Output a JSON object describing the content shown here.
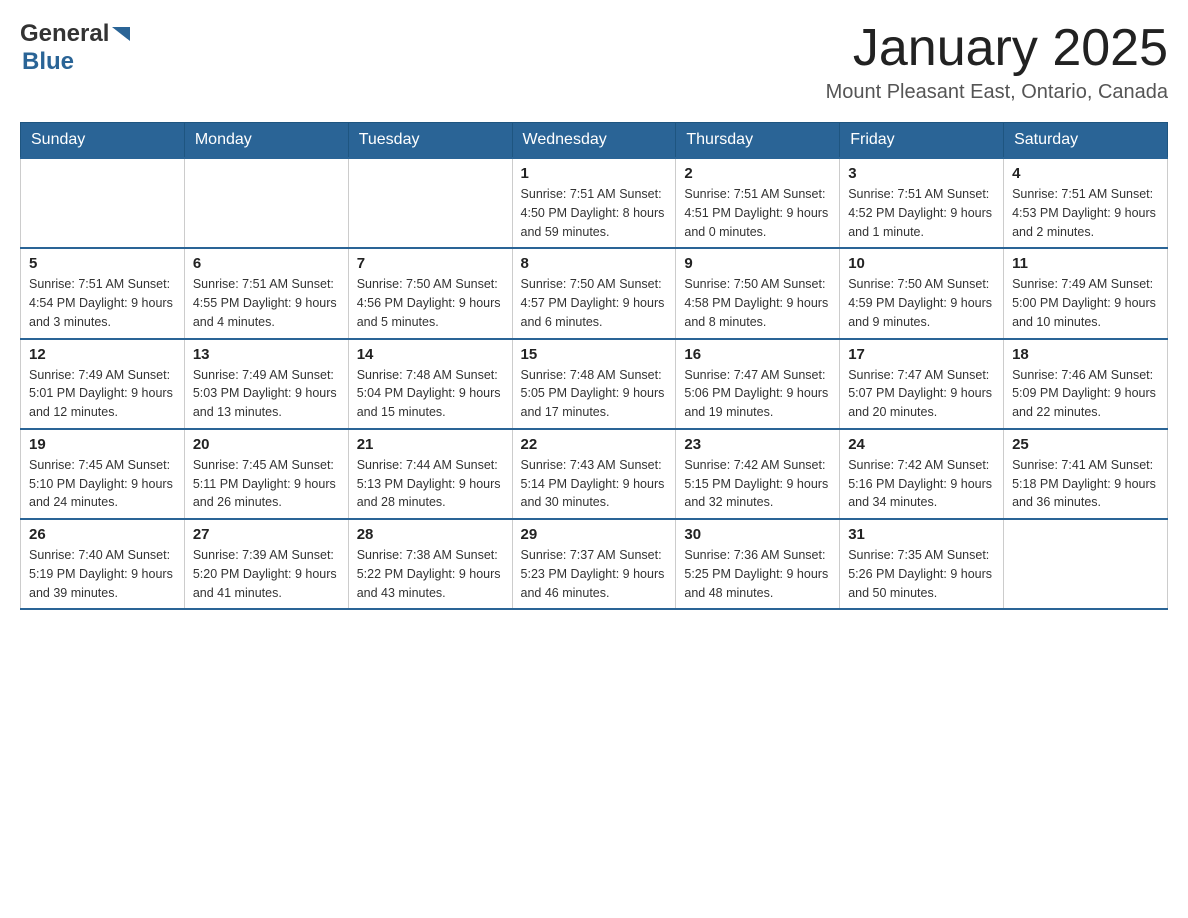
{
  "header": {
    "title": "January 2025",
    "subtitle": "Mount Pleasant East, Ontario, Canada",
    "logo_general": "General",
    "logo_blue": "Blue"
  },
  "days_of_week": [
    "Sunday",
    "Monday",
    "Tuesday",
    "Wednesday",
    "Thursday",
    "Friday",
    "Saturday"
  ],
  "weeks": [
    [
      {
        "day": "",
        "info": ""
      },
      {
        "day": "",
        "info": ""
      },
      {
        "day": "",
        "info": ""
      },
      {
        "day": "1",
        "info": "Sunrise: 7:51 AM\nSunset: 4:50 PM\nDaylight: 8 hours\nand 59 minutes."
      },
      {
        "day": "2",
        "info": "Sunrise: 7:51 AM\nSunset: 4:51 PM\nDaylight: 9 hours\nand 0 minutes."
      },
      {
        "day": "3",
        "info": "Sunrise: 7:51 AM\nSunset: 4:52 PM\nDaylight: 9 hours\nand 1 minute."
      },
      {
        "day": "4",
        "info": "Sunrise: 7:51 AM\nSunset: 4:53 PM\nDaylight: 9 hours\nand 2 minutes."
      }
    ],
    [
      {
        "day": "5",
        "info": "Sunrise: 7:51 AM\nSunset: 4:54 PM\nDaylight: 9 hours\nand 3 minutes."
      },
      {
        "day": "6",
        "info": "Sunrise: 7:51 AM\nSunset: 4:55 PM\nDaylight: 9 hours\nand 4 minutes."
      },
      {
        "day": "7",
        "info": "Sunrise: 7:50 AM\nSunset: 4:56 PM\nDaylight: 9 hours\nand 5 minutes."
      },
      {
        "day": "8",
        "info": "Sunrise: 7:50 AM\nSunset: 4:57 PM\nDaylight: 9 hours\nand 6 minutes."
      },
      {
        "day": "9",
        "info": "Sunrise: 7:50 AM\nSunset: 4:58 PM\nDaylight: 9 hours\nand 8 minutes."
      },
      {
        "day": "10",
        "info": "Sunrise: 7:50 AM\nSunset: 4:59 PM\nDaylight: 9 hours\nand 9 minutes."
      },
      {
        "day": "11",
        "info": "Sunrise: 7:49 AM\nSunset: 5:00 PM\nDaylight: 9 hours\nand 10 minutes."
      }
    ],
    [
      {
        "day": "12",
        "info": "Sunrise: 7:49 AM\nSunset: 5:01 PM\nDaylight: 9 hours\nand 12 minutes."
      },
      {
        "day": "13",
        "info": "Sunrise: 7:49 AM\nSunset: 5:03 PM\nDaylight: 9 hours\nand 13 minutes."
      },
      {
        "day": "14",
        "info": "Sunrise: 7:48 AM\nSunset: 5:04 PM\nDaylight: 9 hours\nand 15 minutes."
      },
      {
        "day": "15",
        "info": "Sunrise: 7:48 AM\nSunset: 5:05 PM\nDaylight: 9 hours\nand 17 minutes."
      },
      {
        "day": "16",
        "info": "Sunrise: 7:47 AM\nSunset: 5:06 PM\nDaylight: 9 hours\nand 19 minutes."
      },
      {
        "day": "17",
        "info": "Sunrise: 7:47 AM\nSunset: 5:07 PM\nDaylight: 9 hours\nand 20 minutes."
      },
      {
        "day": "18",
        "info": "Sunrise: 7:46 AM\nSunset: 5:09 PM\nDaylight: 9 hours\nand 22 minutes."
      }
    ],
    [
      {
        "day": "19",
        "info": "Sunrise: 7:45 AM\nSunset: 5:10 PM\nDaylight: 9 hours\nand 24 minutes."
      },
      {
        "day": "20",
        "info": "Sunrise: 7:45 AM\nSunset: 5:11 PM\nDaylight: 9 hours\nand 26 minutes."
      },
      {
        "day": "21",
        "info": "Sunrise: 7:44 AM\nSunset: 5:13 PM\nDaylight: 9 hours\nand 28 minutes."
      },
      {
        "day": "22",
        "info": "Sunrise: 7:43 AM\nSunset: 5:14 PM\nDaylight: 9 hours\nand 30 minutes."
      },
      {
        "day": "23",
        "info": "Sunrise: 7:42 AM\nSunset: 5:15 PM\nDaylight: 9 hours\nand 32 minutes."
      },
      {
        "day": "24",
        "info": "Sunrise: 7:42 AM\nSunset: 5:16 PM\nDaylight: 9 hours\nand 34 minutes."
      },
      {
        "day": "25",
        "info": "Sunrise: 7:41 AM\nSunset: 5:18 PM\nDaylight: 9 hours\nand 36 minutes."
      }
    ],
    [
      {
        "day": "26",
        "info": "Sunrise: 7:40 AM\nSunset: 5:19 PM\nDaylight: 9 hours\nand 39 minutes."
      },
      {
        "day": "27",
        "info": "Sunrise: 7:39 AM\nSunset: 5:20 PM\nDaylight: 9 hours\nand 41 minutes."
      },
      {
        "day": "28",
        "info": "Sunrise: 7:38 AM\nSunset: 5:22 PM\nDaylight: 9 hours\nand 43 minutes."
      },
      {
        "day": "29",
        "info": "Sunrise: 7:37 AM\nSunset: 5:23 PM\nDaylight: 9 hours\nand 46 minutes."
      },
      {
        "day": "30",
        "info": "Sunrise: 7:36 AM\nSunset: 5:25 PM\nDaylight: 9 hours\nand 48 minutes."
      },
      {
        "day": "31",
        "info": "Sunrise: 7:35 AM\nSunset: 5:26 PM\nDaylight: 9 hours\nand 50 minutes."
      },
      {
        "day": "",
        "info": ""
      }
    ]
  ]
}
